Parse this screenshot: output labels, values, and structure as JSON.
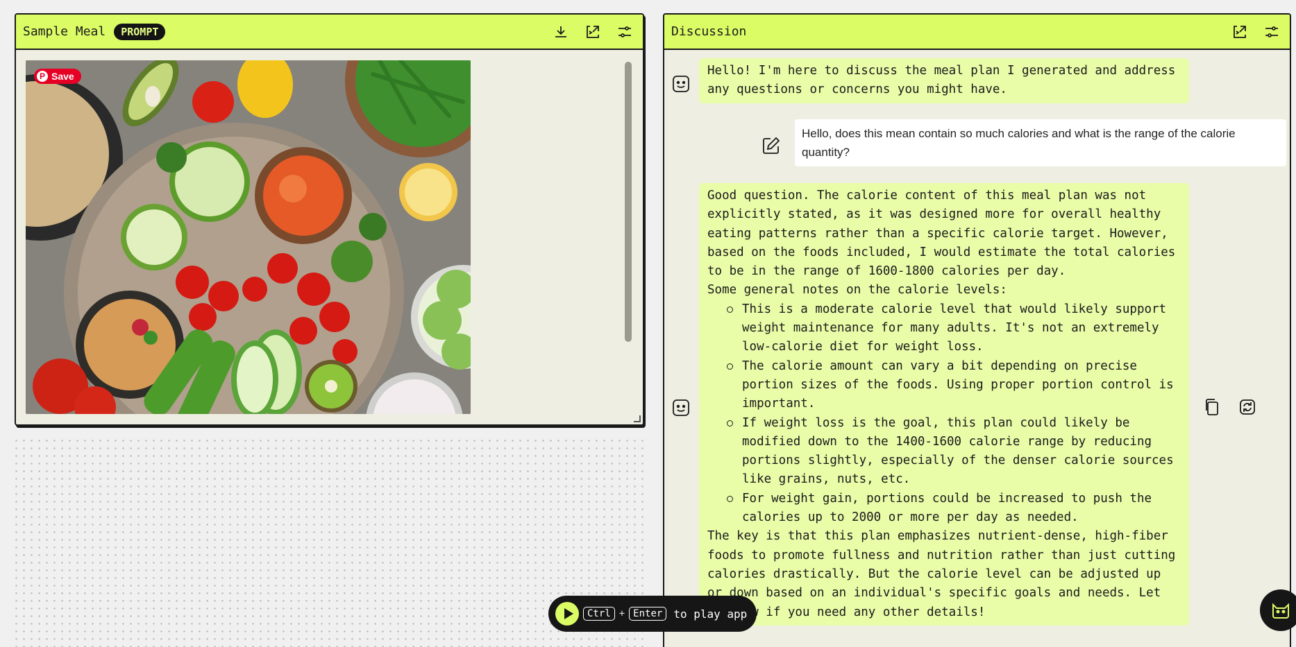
{
  "left_panel": {
    "title": "Sample Meal",
    "badge": "PROMPT",
    "pin_save_label": "Save",
    "icons": [
      "download-icon",
      "export-icon",
      "settings-sliders-icon"
    ]
  },
  "right_panel": {
    "title": "Discussion",
    "icons": [
      "export-icon",
      "settings-sliders-icon"
    ],
    "messages": [
      {
        "role": "assistant",
        "text": "Hello! I'm here to discuss the meal plan I generated and address any questions or concerns you might have."
      },
      {
        "role": "user",
        "text": "Hello, does this mean contain so much calories and what is the range of the calorie quantity?"
      },
      {
        "role": "assistant",
        "intro": "Good question. The calorie content of this meal plan was not explicitly stated, as it was designed more for overall healthy eating patterns rather than a specific calorie target. However, based on the foods included, I would estimate the total calories to be in the range of 1600-1800 calories per day.",
        "notes_heading": "Some general notes on the calorie levels:",
        "bullets": [
          "This is a moderate calorie level that would likely support weight maintenance for many adults. It's not an extremely low-calorie diet for weight loss.",
          "The calorie amount can vary a bit depending on precise portion sizes of the foods. Using proper portion control is important.",
          "If weight loss is the goal, this plan could likely be modified down to the 1400-1600 calorie range by reducing portions slightly, especially of the denser calorie sources like grains, nuts, etc.",
          "For weight gain, portions could be increased to push the calories up to 2000 or more per day as needed."
        ],
        "closing": "The key is that this plan emphasizes nutrient-dense, high-fiber foods to promote fullness and nutrition rather than just cutting calories drastically. But the calorie level can be adjusted up or down based on an individual's specific goals and needs. Let me know if you need any other details!"
      }
    ]
  },
  "play_bar": {
    "key1": "Ctrl",
    "plus": "+",
    "key2": "Enter",
    "label": "to play app"
  },
  "colors": {
    "accent": "#dcfc66",
    "ai_bubble": "#e9fca8",
    "panel_bg": "#eeeee2",
    "dark": "#161616"
  }
}
